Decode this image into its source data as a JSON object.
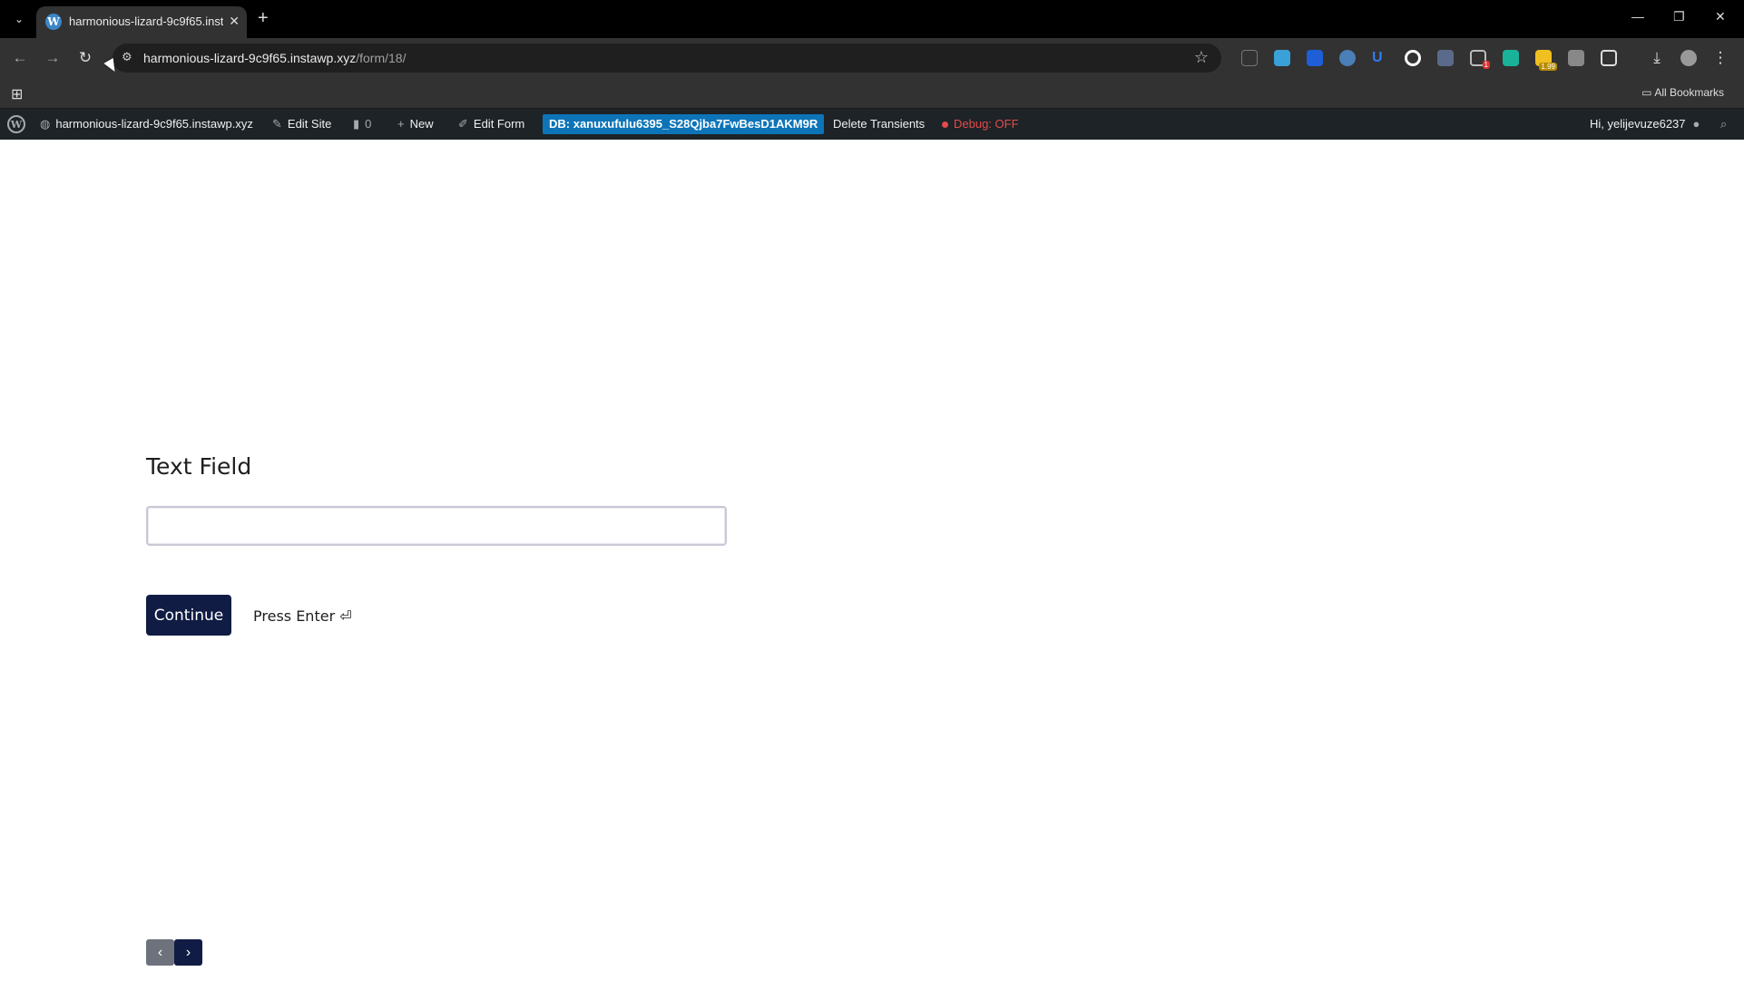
{
  "browser": {
    "tab_title": "harmonious-lizard-9c9f65.insta",
    "url_host": "harmonious-lizard-9c9f65.instawp.xyz",
    "url_path": "/form/18/",
    "bookmarks_label": "All Bookmarks",
    "extension_badge_count": "1",
    "extension_price_badge": "1.99"
  },
  "wp_admin_bar": {
    "site_name": "harmonious-lizard-9c9f65.instawp.xyz",
    "edit_site": "Edit Site",
    "comments_count": "0",
    "new_label": "New",
    "edit_form": "Edit Form",
    "db_label": "DB: xanuxufulu6395_S28Qjba7FwBesD1AKM9R",
    "delete_transients": "Delete Transients",
    "debug_label": "Debug: OFF",
    "greeting": "Hi, yelijevuze6237"
  },
  "form": {
    "field_label": "Text Field",
    "field_value": "",
    "continue_label": "Continue",
    "press_enter_label": "Press Enter ⏎"
  },
  "colors": {
    "primary_button": "#101c44",
    "db_badge": "#0d74b8",
    "debug_off": "#e34b4b"
  }
}
